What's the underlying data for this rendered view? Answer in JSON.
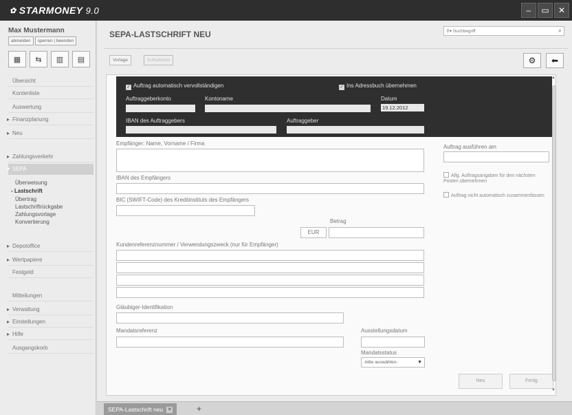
{
  "app": {
    "logo_text": "STARMONEY",
    "version": "9.0",
    "window_buttons": [
      "–",
      "▭",
      "✕"
    ]
  },
  "sidebar": {
    "user_name": "Max Mustermann",
    "user_buttons": [
      "abmelden",
      "sperren | beenden"
    ],
    "tool_icons": [
      "cards-icon",
      "transfer-icon",
      "chart-icon",
      "document-icon"
    ],
    "items": [
      {
        "label": "Übersicht",
        "arrow": false
      },
      {
        "label": "Kontenliste",
        "arrow": false
      },
      {
        "label": "Auswertung",
        "arrow": false
      },
      {
        "label": "Finanzplanung",
        "arrow": true
      },
      {
        "label": "Neu",
        "arrow": true
      },
      {
        "label": "Zahlungsverkehr",
        "arrow": true
      },
      {
        "label": "SEPA",
        "arrow": true,
        "active": true
      },
      {
        "label": "Depotoffice",
        "arrow": true
      },
      {
        "label": "Wertpapiere",
        "arrow": true
      },
      {
        "label": "Festgeld",
        "arrow": false
      },
      {
        "label": "Mitteilungen",
        "arrow": false
      },
      {
        "label": "Verwaltung",
        "arrow": true
      },
      {
        "label": "Einstellungen",
        "arrow": true
      },
      {
        "label": "Hilfe",
        "arrow": true
      },
      {
        "label": "Ausgangskorb",
        "arrow": false
      }
    ],
    "sepa_sub": [
      {
        "label": "Überweisung",
        "bold": false
      },
      {
        "label": "- Lastschrift",
        "bold": true
      },
      {
        "label": "Übertrag",
        "bold": false
      },
      {
        "label": "Lastschriftrückgabe",
        "bold": false
      },
      {
        "label": "Zahlungsvorlage",
        "bold": false
      },
      {
        "label": "Konvertierung",
        "bold": false
      }
    ]
  },
  "main": {
    "title": "SEPA-LASTSCHRIFT NEU",
    "search_placeholder": "Suchbegriff",
    "toolbar": {
      "vorlage": "Vorlage",
      "ausfuehren": "Aufnahmen"
    },
    "form": {
      "check_auto": "Auftrag automatisch vervollständigen",
      "check_adressbuch": "Ins Adressbuch übernehmen",
      "auftraggeberkonto": "Auftraggeberkonto",
      "kontoname": "Kontoname",
      "datum_label": "Datum",
      "datum_value": "19.12.2012",
      "iban_auftraggeber": "IBAN des Auftraggebers",
      "auftraggeber": "Auftraggeber",
      "empfaenger": "Empfänger: Name, Vorname / Firma",
      "iban_empfaenger": "IBAN des Empfängers",
      "bic": "BIC (SWIFT-Code) des Kreditinstituts des Empfängers",
      "betrag": "Betrag",
      "currency": "EUR",
      "verwendungszweck": "Kundenreferenznummer / Verwendungszweck (nur für Empfänger)",
      "glaeubiger": "Gläubiger-Identifikation",
      "mandatsreferenz": "Mandatsreferenz",
      "ausstellungsdatum": "Ausstellungsdatum",
      "mandatsstatus": "Mandatsstatus",
      "mandatsstatus_value": "-bitte auswählen-",
      "ausfuehren_am": "Auftrag ausführen am",
      "check_allg": "Allg. Auftragsangaben für den nächsten Posten übernehmen",
      "check_nicht_zusammen": "Auftrag nicht automatisch zusammenfassen",
      "btn_neu": "Neu",
      "btn_fertig": "Fertig"
    }
  },
  "tabs": [
    {
      "label": "SEPA-Lastschrift neu"
    }
  ],
  "colors": {
    "titlebar": "#2e2e2e",
    "dark_box": "#2f2f2f",
    "background": "#ececec"
  }
}
